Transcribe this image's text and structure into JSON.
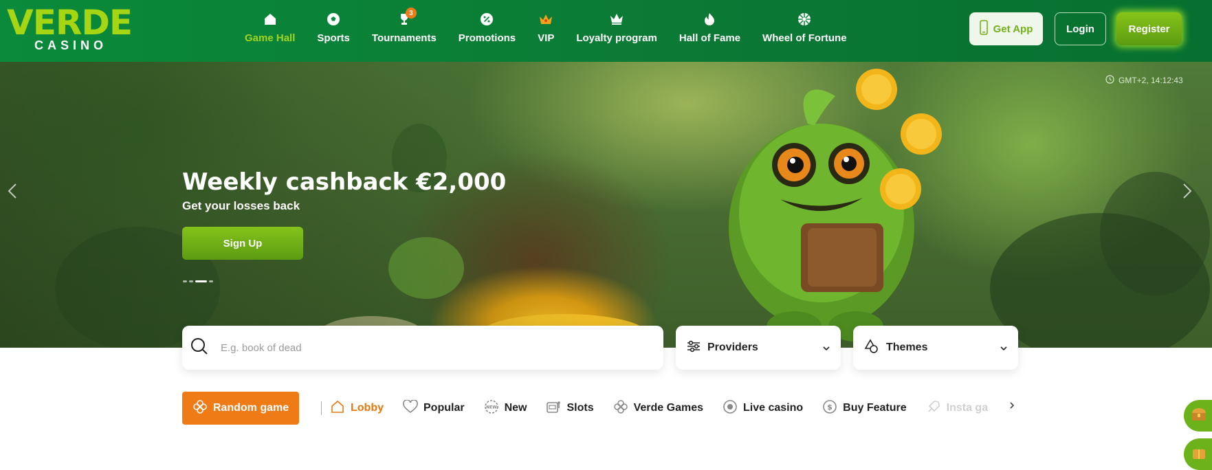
{
  "brand": {
    "name": "VERDE",
    "sub": "CASINO",
    "color": "#a6d613"
  },
  "nav": {
    "items": [
      {
        "label": "Game Hall",
        "icon": "home-icon",
        "active": true
      },
      {
        "label": "Sports",
        "icon": "soccer-ball-icon"
      },
      {
        "label": "Tournaments",
        "icon": "trophy-icon",
        "badge": "3"
      },
      {
        "label": "Promotions",
        "icon": "percent-badge-icon"
      },
      {
        "label": "VIP",
        "icon": "crown-icon"
      },
      {
        "label": "Loyalty program",
        "icon": "crown-outline-icon"
      },
      {
        "label": "Hall of Fame",
        "icon": "flame-icon"
      },
      {
        "label": "Wheel of Fortune",
        "icon": "wheel-icon"
      }
    ]
  },
  "header_buttons": {
    "get_app": "Get App",
    "login": "Login",
    "register": "Register"
  },
  "hero": {
    "title": "Weekly cashback €2,000",
    "subtitle": "Get your losses back",
    "cta": "Sign Up",
    "clock": "GMT+2,  14:12:43",
    "slide_count": 4,
    "active_slide": 3
  },
  "search": {
    "placeholder": "E.g. book of dead"
  },
  "filters": {
    "providers": "Providers",
    "themes": "Themes"
  },
  "categories": {
    "random": "Random game",
    "items": [
      {
        "label": "Lobby",
        "icon": "home-outline-icon",
        "active": true
      },
      {
        "label": "Popular",
        "icon": "heart-icon"
      },
      {
        "label": "New",
        "icon": "new-badge-icon"
      },
      {
        "label": "Slots",
        "icon": "slot-machine-icon"
      },
      {
        "label": "Verde Games",
        "icon": "clover-icon"
      },
      {
        "label": "Live casino",
        "icon": "live-dot-icon"
      },
      {
        "label": "Buy Feature",
        "icon": "dollar-badge-icon"
      },
      {
        "label": "Insta ga",
        "icon": "rocket-icon",
        "faded": true
      }
    ]
  },
  "colors": {
    "header_green": "#0a8a3a",
    "accent_lime": "#9fd420",
    "orange": "#ef7b17"
  }
}
